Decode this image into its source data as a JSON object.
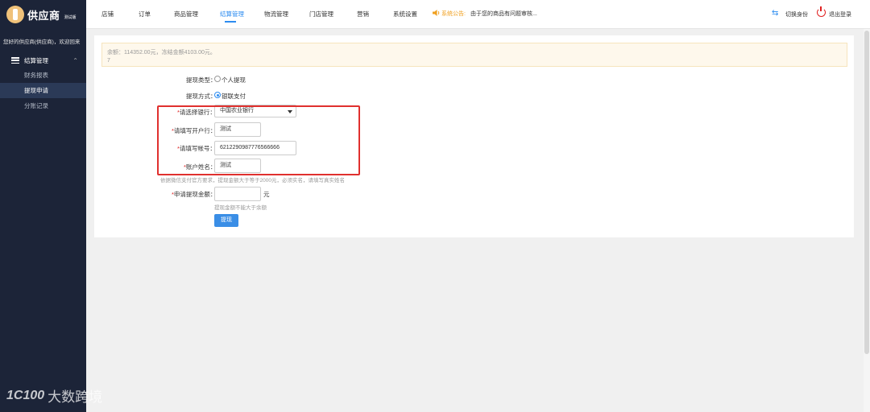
{
  "sidebar": {
    "logo_text": "供应商",
    "logo_sub": "测试版",
    "welcome": "您好的供应商(供应商)，欢迎回来",
    "menu_group": "结算管理",
    "items": [
      {
        "label": "财务报表"
      },
      {
        "label": "提现申请"
      },
      {
        "label": "分账记录"
      }
    ]
  },
  "topnav": {
    "items": [
      {
        "label": "店铺"
      },
      {
        "label": "订单"
      },
      {
        "label": "商品管理"
      },
      {
        "label": "结算管理"
      },
      {
        "label": "物流管理"
      },
      {
        "label": "门店管理"
      },
      {
        "label": "营销"
      },
      {
        "label": "系统设置"
      }
    ],
    "announce_label": "系统公告:",
    "announce_text": "由于您的商品有问题审核...",
    "switch_label": "切换身份",
    "logout_label": "退出登录"
  },
  "notice": {
    "line1": "余额：114352.00元，冻结金额4103.00元。",
    "line2": "7"
  },
  "form": {
    "type_label": "提现类型：",
    "type_option": "个人提现",
    "method_label": "提现方式：",
    "method_option": "银联支付",
    "bank_label": "请选择银行：",
    "bank_value": "中国农业银行",
    "branch_label": "请填写开户行：",
    "branch_value": "测试",
    "account_label": "请填写帐号：",
    "account_value": "6212290987776566666",
    "name_label": "账户姓名：",
    "name_value": "测试",
    "name_hint": "依据微信支付官方要求，提现金额大于等于2000元，必须实名，请填写真实姓名",
    "amount_label": "申请提现金额：",
    "amount_value": "",
    "amount_unit": "元",
    "amount_hint": "提现金额不能大于余额",
    "submit_label": "提现"
  },
  "watermark": {
    "mark": "1C100",
    "text": "大数跨境"
  },
  "colors": {
    "sidebar_bg": "#1c2438",
    "accent": "#2d8cf0",
    "highlight": "#e0302e",
    "notice_bg": "#fef8ec"
  }
}
